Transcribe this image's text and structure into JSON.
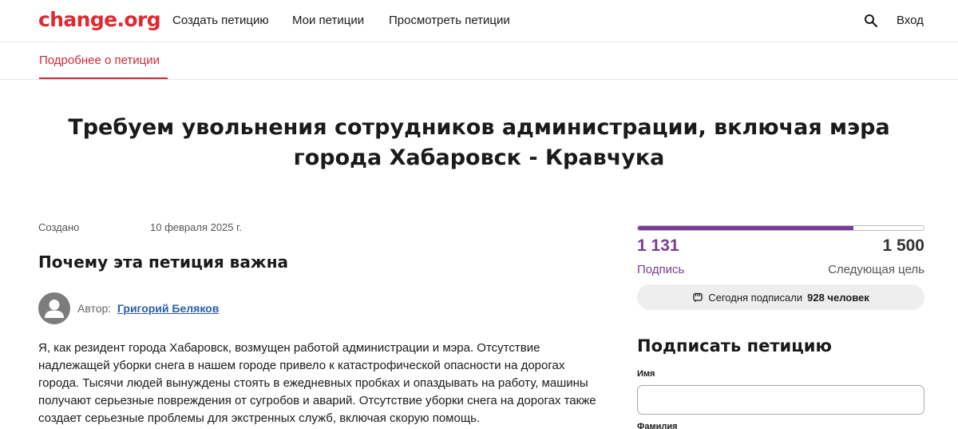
{
  "header": {
    "logo": "change.org",
    "nav": [
      "Создать петицию",
      "Мои петиции",
      "Просмотреть петиции"
    ],
    "login": "Вход"
  },
  "tabs": {
    "active": "Подробнее о петиции"
  },
  "petition": {
    "title": "Требуем увольнения сотрудников администрации, включая мэра города Хабаровск - Кравчука",
    "created_label": "Создано",
    "created_date": "10 февраля 2025 г.",
    "section_heading": "Почему эта петиция важна",
    "author_prefix": "Автор:",
    "author_name": "Григорий Беляков",
    "body": "Я, как резидент города Хабаровск, возмущен работой администрации и мэра. Отсутствие надлежащей уборки снега в нашем городе привело к катастрофической опасности на дорогах города. Тысячи людей вынуждены стоять в ежедневных пробках и опаздывать на работу, машины получают серьезные повреждения от сугробов и аварий. Отсутствие уборки снега на дорогах также создает серьезные проблемы для экстренных служб, включая скорую помощь."
  },
  "progress": {
    "signatures": "1 131",
    "goal": "1 500",
    "fraction": 0.754,
    "sig_label": "Подпись",
    "goal_label": "Следующая цель",
    "today_prefix": "Сегодня подписали",
    "today_count": "928 человек"
  },
  "sign_form": {
    "heading": "Подписать петицию",
    "first_name_label": "Имя",
    "first_name_value": "",
    "last_name_label": "Фамилия"
  },
  "colors": {
    "brand": "#e0282e",
    "progress": "#7a3b98",
    "tab_active": "#d0293a",
    "link": "#2a5fa6"
  },
  "icons": {
    "search": "search-icon",
    "avatar": "user-avatar-icon",
    "today": "raised-fist-icon"
  }
}
